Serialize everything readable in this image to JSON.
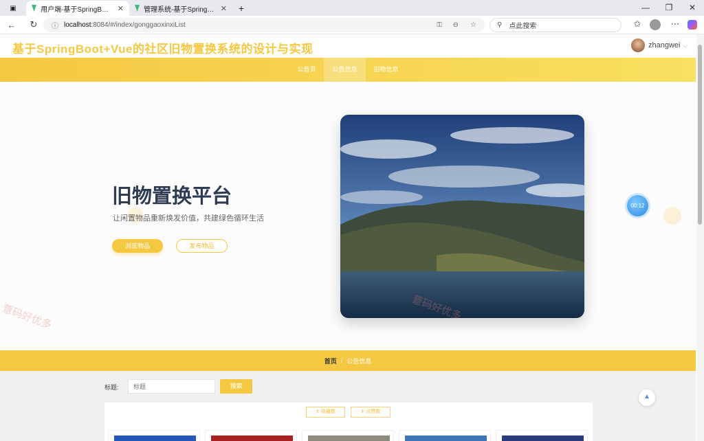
{
  "browser": {
    "tabs": [
      {
        "title": "用户端-基于SpringBoot+Vue的社",
        "active": true
      },
      {
        "title": "管理系统-基于SpringBoot+Vue的",
        "active": false
      }
    ],
    "new_tab": "+",
    "address": {
      "host": "localhost",
      "path": ":8084/#/index/gonggaoxinxiList"
    },
    "search_placeholder": "点此搜索",
    "window_controls": {
      "minimize": "—",
      "maximize": "❐",
      "close": "✕"
    }
  },
  "header": {
    "site_title": "基于SpringBoot+Vue的社区旧物置换系统的设计与实现",
    "user_name": "zhangwei"
  },
  "nav": {
    "items": [
      {
        "label": "公首页",
        "active": false
      },
      {
        "label": "公告信息",
        "active": true
      },
      {
        "label": "旧物信息",
        "active": false
      }
    ]
  },
  "hero": {
    "title": "旧物置换平台",
    "subtitle": "让闲置物品重新焕发价值，共建绿色循环生活",
    "browse_button": "浏览物品",
    "publish_button": "发布物品"
  },
  "timer": "00:12",
  "breadcrumb": {
    "home": "首页",
    "current": "公告信息"
  },
  "list": {
    "title_label": "标题:",
    "title_placeholder": "标题",
    "search_button": "搜索",
    "sort_favorites": "⇕ 收藏数",
    "sort_likes": "⇕ 点赞数"
  },
  "watermark": "薏码好优多",
  "colors": {
    "accent": "#f5c842",
    "nav_end": "#f8e060",
    "title": "#2f3b52"
  }
}
